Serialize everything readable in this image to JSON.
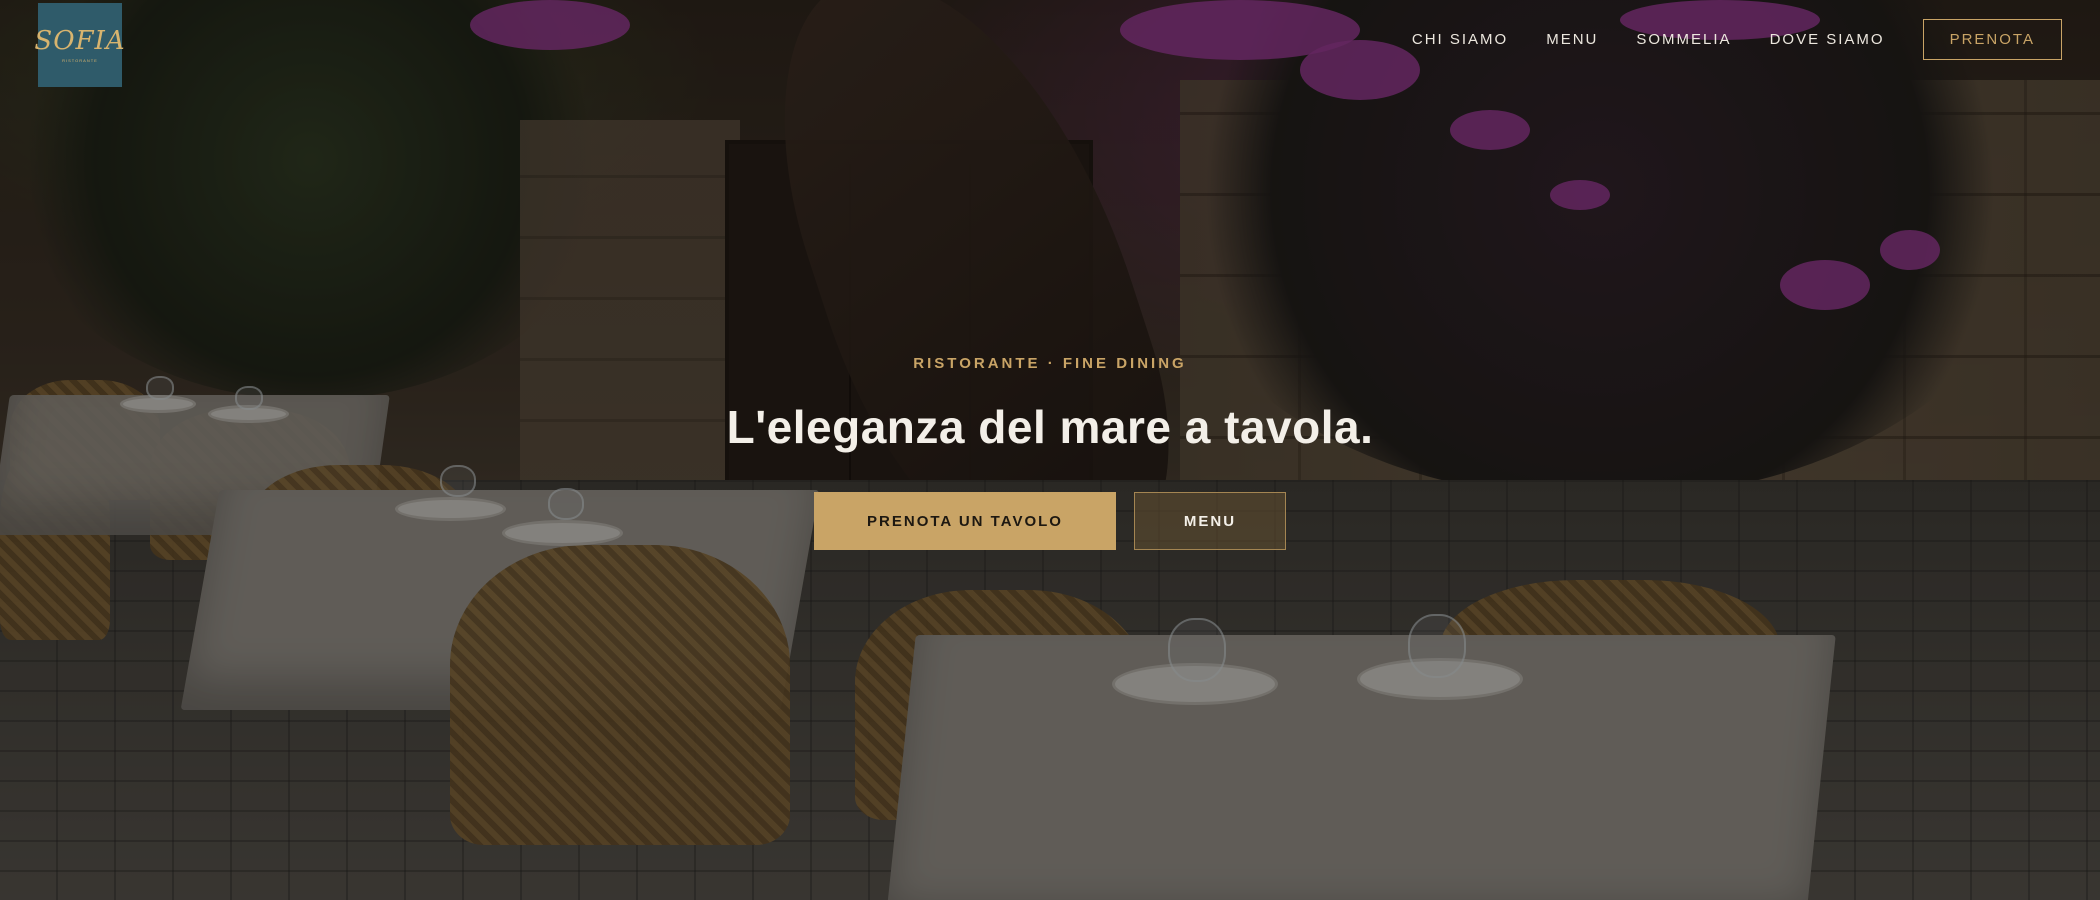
{
  "brand": {
    "logo_text": "SOFIA",
    "logo_subtext": "RISTORANTE",
    "logo_bg": "#2f5b6a",
    "logo_color": "#d8b46e"
  },
  "nav": {
    "items": [
      {
        "label": "CHI SIAMO"
      },
      {
        "label": "MENU"
      },
      {
        "label": "SOMMELIA"
      },
      {
        "label": "DOVE SIAMO"
      }
    ],
    "cta_label": "PRENOTA"
  },
  "hero": {
    "eyebrow": "RISTORANTE · FINE DINING",
    "headline": "L'eleganza del mare a tavola.",
    "primary_cta": "PRENOTA UN TAVOLO",
    "secondary_cta": "MENU"
  },
  "colors": {
    "accent": "#c9a466",
    "text_light": "#f3efe8"
  }
}
